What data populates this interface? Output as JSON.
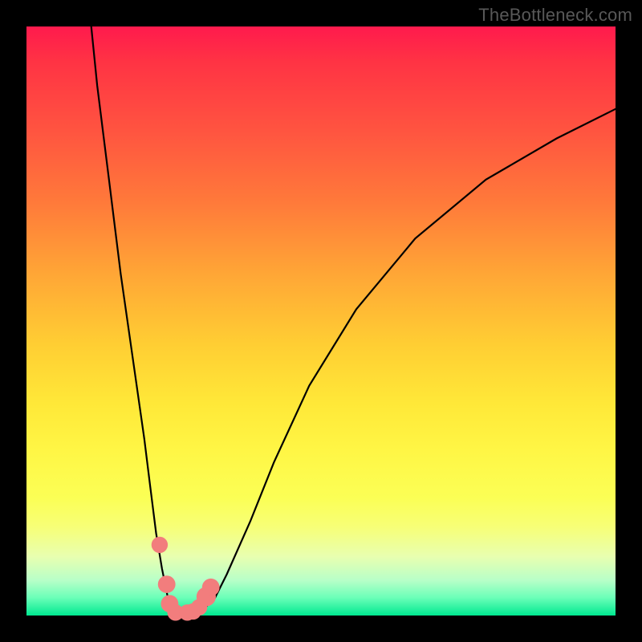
{
  "watermark": "TheBottleneck.com",
  "chart_data": {
    "type": "line",
    "title": "",
    "xlabel": "",
    "ylabel": "",
    "xlim": [
      0,
      100
    ],
    "ylim": [
      0,
      100
    ],
    "series": [
      {
        "name": "curve",
        "x": [
          11,
          12,
          14,
          16,
          18,
          20,
          21,
          22,
          23,
          24,
          25,
          26,
          27,
          28,
          30,
          32,
          34,
          38,
          42,
          48,
          56,
          66,
          78,
          90,
          100
        ],
        "y": [
          100,
          90,
          74,
          58,
          44,
          30,
          22,
          14,
          8,
          3,
          1,
          0,
          0,
          0,
          1,
          3,
          7,
          16,
          26,
          39,
          52,
          64,
          74,
          81,
          86
        ]
      }
    ],
    "markers": [
      {
        "x": 22.6,
        "y": 12.0,
        "r": 1.0
      },
      {
        "x": 23.8,
        "y": 5.3,
        "r": 1.1
      },
      {
        "x": 24.3,
        "y": 2.0,
        "r": 1.1
      },
      {
        "x": 25.3,
        "y": 0.5,
        "r": 1.0
      },
      {
        "x": 27.3,
        "y": 0.5,
        "r": 1.0
      },
      {
        "x": 28.3,
        "y": 0.7,
        "r": 1.0
      },
      {
        "x": 29.3,
        "y": 1.4,
        "r": 1.0
      },
      {
        "x": 30.5,
        "y": 3.2,
        "r": 1.3
      },
      {
        "x": 31.3,
        "y": 4.8,
        "r": 1.1
      }
    ],
    "marker_color": "#f27d7d",
    "curve_color": "#000000"
  }
}
